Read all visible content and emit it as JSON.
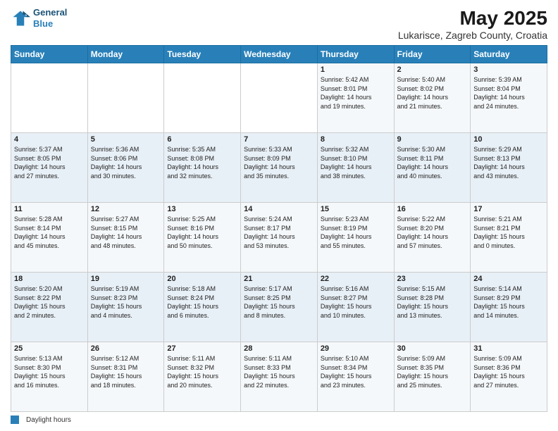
{
  "header": {
    "logo_line1": "General",
    "logo_line2": "Blue",
    "title": "May 2025",
    "subtitle": "Lukarisce, Zagreb County, Croatia"
  },
  "days_of_week": [
    "Sunday",
    "Monday",
    "Tuesday",
    "Wednesday",
    "Thursday",
    "Friday",
    "Saturday"
  ],
  "weeks": [
    [
      {
        "num": "",
        "text": ""
      },
      {
        "num": "",
        "text": ""
      },
      {
        "num": "",
        "text": ""
      },
      {
        "num": "",
        "text": ""
      },
      {
        "num": "1",
        "text": "Sunrise: 5:42 AM\nSunset: 8:01 PM\nDaylight: 14 hours\nand 19 minutes."
      },
      {
        "num": "2",
        "text": "Sunrise: 5:40 AM\nSunset: 8:02 PM\nDaylight: 14 hours\nand 21 minutes."
      },
      {
        "num": "3",
        "text": "Sunrise: 5:39 AM\nSunset: 8:04 PM\nDaylight: 14 hours\nand 24 minutes."
      }
    ],
    [
      {
        "num": "4",
        "text": "Sunrise: 5:37 AM\nSunset: 8:05 PM\nDaylight: 14 hours\nand 27 minutes."
      },
      {
        "num": "5",
        "text": "Sunrise: 5:36 AM\nSunset: 8:06 PM\nDaylight: 14 hours\nand 30 minutes."
      },
      {
        "num": "6",
        "text": "Sunrise: 5:35 AM\nSunset: 8:08 PM\nDaylight: 14 hours\nand 32 minutes."
      },
      {
        "num": "7",
        "text": "Sunrise: 5:33 AM\nSunset: 8:09 PM\nDaylight: 14 hours\nand 35 minutes."
      },
      {
        "num": "8",
        "text": "Sunrise: 5:32 AM\nSunset: 8:10 PM\nDaylight: 14 hours\nand 38 minutes."
      },
      {
        "num": "9",
        "text": "Sunrise: 5:30 AM\nSunset: 8:11 PM\nDaylight: 14 hours\nand 40 minutes."
      },
      {
        "num": "10",
        "text": "Sunrise: 5:29 AM\nSunset: 8:13 PM\nDaylight: 14 hours\nand 43 minutes."
      }
    ],
    [
      {
        "num": "11",
        "text": "Sunrise: 5:28 AM\nSunset: 8:14 PM\nDaylight: 14 hours\nand 45 minutes."
      },
      {
        "num": "12",
        "text": "Sunrise: 5:27 AM\nSunset: 8:15 PM\nDaylight: 14 hours\nand 48 minutes."
      },
      {
        "num": "13",
        "text": "Sunrise: 5:25 AM\nSunset: 8:16 PM\nDaylight: 14 hours\nand 50 minutes."
      },
      {
        "num": "14",
        "text": "Sunrise: 5:24 AM\nSunset: 8:17 PM\nDaylight: 14 hours\nand 53 minutes."
      },
      {
        "num": "15",
        "text": "Sunrise: 5:23 AM\nSunset: 8:19 PM\nDaylight: 14 hours\nand 55 minutes."
      },
      {
        "num": "16",
        "text": "Sunrise: 5:22 AM\nSunset: 8:20 PM\nDaylight: 14 hours\nand 57 minutes."
      },
      {
        "num": "17",
        "text": "Sunrise: 5:21 AM\nSunset: 8:21 PM\nDaylight: 15 hours\nand 0 minutes."
      }
    ],
    [
      {
        "num": "18",
        "text": "Sunrise: 5:20 AM\nSunset: 8:22 PM\nDaylight: 15 hours\nand 2 minutes."
      },
      {
        "num": "19",
        "text": "Sunrise: 5:19 AM\nSunset: 8:23 PM\nDaylight: 15 hours\nand 4 minutes."
      },
      {
        "num": "20",
        "text": "Sunrise: 5:18 AM\nSunset: 8:24 PM\nDaylight: 15 hours\nand 6 minutes."
      },
      {
        "num": "21",
        "text": "Sunrise: 5:17 AM\nSunset: 8:25 PM\nDaylight: 15 hours\nand 8 minutes."
      },
      {
        "num": "22",
        "text": "Sunrise: 5:16 AM\nSunset: 8:27 PM\nDaylight: 15 hours\nand 10 minutes."
      },
      {
        "num": "23",
        "text": "Sunrise: 5:15 AM\nSunset: 8:28 PM\nDaylight: 15 hours\nand 13 minutes."
      },
      {
        "num": "24",
        "text": "Sunrise: 5:14 AM\nSunset: 8:29 PM\nDaylight: 15 hours\nand 14 minutes."
      }
    ],
    [
      {
        "num": "25",
        "text": "Sunrise: 5:13 AM\nSunset: 8:30 PM\nDaylight: 15 hours\nand 16 minutes."
      },
      {
        "num": "26",
        "text": "Sunrise: 5:12 AM\nSunset: 8:31 PM\nDaylight: 15 hours\nand 18 minutes."
      },
      {
        "num": "27",
        "text": "Sunrise: 5:11 AM\nSunset: 8:32 PM\nDaylight: 15 hours\nand 20 minutes."
      },
      {
        "num": "28",
        "text": "Sunrise: 5:11 AM\nSunset: 8:33 PM\nDaylight: 15 hours\nand 22 minutes."
      },
      {
        "num": "29",
        "text": "Sunrise: 5:10 AM\nSunset: 8:34 PM\nDaylight: 15 hours\nand 23 minutes."
      },
      {
        "num": "30",
        "text": "Sunrise: 5:09 AM\nSunset: 8:35 PM\nDaylight: 15 hours\nand 25 minutes."
      },
      {
        "num": "31",
        "text": "Sunrise: 5:09 AM\nSunset: 8:36 PM\nDaylight: 15 hours\nand 27 minutes."
      }
    ]
  ],
  "footer": {
    "legend_label": "Daylight hours"
  }
}
